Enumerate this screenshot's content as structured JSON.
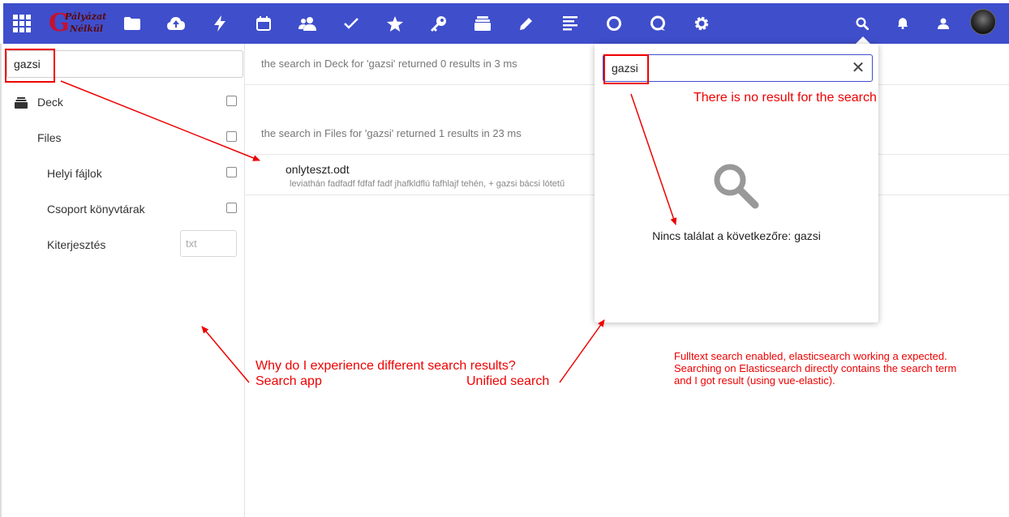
{
  "header": {
    "logo": {
      "mark": "G",
      "line1": "Pályázat",
      "line2": "Nélkül"
    },
    "icons": [
      "grid-icon",
      "folder-icon",
      "cloud-upload-icon",
      "activity-icon",
      "calendar-icon",
      "contacts-icon",
      "tasks-icon",
      "star-icon",
      "key-icon",
      "deck-icon",
      "pencil-icon",
      "notes-icon",
      "circle-icon",
      "talk-icon",
      "gear-icon",
      "search-icon",
      "bell-icon",
      "contacts-menu-icon"
    ],
    "accent": "#3f4ecb"
  },
  "sidebar": {
    "search_value": "gazsi",
    "providers": [
      {
        "label": "Deck",
        "checked": false
      },
      {
        "label": "Files",
        "checked": false
      },
      {
        "label": "Helyi fájlok",
        "checked": false
      },
      {
        "label": "Csoport könyvtárak",
        "checked": false
      }
    ],
    "extension": {
      "label": "Kiterjesztés",
      "placeholder": "txt"
    }
  },
  "results": {
    "deck_info": "the search in Deck for 'gazsi' returned 0 results in 3 ms",
    "files_info": "the search in Files for 'gazsi' returned 1 results in 23 ms",
    "file": {
      "name": "onlyteszt.odt",
      "excerpt": "leviathán fadfadf fdfaf fadf jhafkldflú fafhlajf tehén, + gazsi bácsi lótetű"
    }
  },
  "unified_search": {
    "value": "gazsi",
    "clear_symbol": "✕",
    "empty_message": "Nincs találat a következőre: gazsi"
  },
  "annotations": {
    "no_result": "There is no result for the search",
    "question": "Why do I experience different search results?",
    "search_app": "Search app",
    "unified": "Unified search",
    "note_line1": "Fulltext search enabled, elasticsearch working a expected.",
    "note_line2": "Searching on Elasticsearch directly contains the search term",
    "note_line3": "and I got result (using vue-elastic).",
    "color": "#e00000"
  }
}
